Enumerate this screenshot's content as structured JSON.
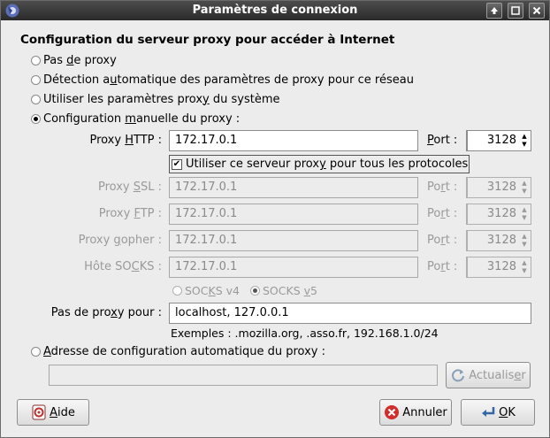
{
  "window": {
    "title": "Paramètres de connexion"
  },
  "section": {
    "heading": "Configuration du serveur proxy pour accéder à Internet"
  },
  "proxy_modes": [
    {
      "label_pre": "Pas ",
      "label_u": "d",
      "label_post": "e proxy",
      "checked": false
    },
    {
      "label_pre": "Détection a",
      "label_u": "u",
      "label_post": "tomatique des paramètres de proxy pour ce réseau",
      "checked": false
    },
    {
      "label_pre": "Utiliser les paramètres prox",
      "label_u": "y",
      "label_post": " du système",
      "checked": false
    },
    {
      "label_pre": "Configuration ",
      "label_u": "m",
      "label_post": "anuelle du proxy :",
      "checked": true
    }
  ],
  "http": {
    "label_pre": "Proxy ",
    "label_u": "H",
    "label_post": "TTP :",
    "value": "172.17.0.1",
    "port_label_u": "P",
    "port_label_post": "ort :",
    "port": "3128"
  },
  "use_for_all": {
    "label_pre": "Utiliser ce serveur prox",
    "label_u": "y",
    "label_post": " pour tous les protocoles",
    "checked": true,
    "check_glyph": "✔"
  },
  "ssl": {
    "label_pre": "Proxy ",
    "label_u": "S",
    "label_post": "SL :",
    "value": "172.17.0.1",
    "port_label_pre": "Po",
    "port_label_u": "r",
    "port_label_post": "t :",
    "port": "3128"
  },
  "ftp": {
    "label_pre": "Proxy ",
    "label_u": "F",
    "label_post": "TP :",
    "value": "172.17.0.1",
    "port_label_pre": "Po",
    "port_label_u": "r",
    "port_label_post": "t :",
    "port": "3128"
  },
  "gopher": {
    "label_pre": "Proxy ",
    "label_u": "g",
    "label_post": "opher :",
    "value": "172.17.0.1",
    "port_label_pre": "Po",
    "port_label_u": "r",
    "port_label_post": "t :",
    "port": "3128"
  },
  "socks": {
    "label_pre": "Hôte SO",
    "label_u": "C",
    "label_post": "KS :",
    "value": "172.17.0.1",
    "port_label_pre": "Po",
    "port_label_u": "r",
    "port_label_post": "t :",
    "port": "3128",
    "v4_pre": "SOC",
    "v4_u": "K",
    "v4_post": "S v4",
    "v5_pre": "SOCKS ",
    "v5_u": "v",
    "v5_post": "5",
    "selected": "v5"
  },
  "no_proxy": {
    "label_pre": "Pas de pro",
    "label_u": "x",
    "label_post": "y pour :",
    "value": "localhost, 127.0.0.1",
    "examples": "Exemples : .mozilla.org, .asso.fr, 192.168.1.0/24"
  },
  "auto_config": {
    "label_u": "A",
    "label_post": "dresse de configuration automatique du proxy :",
    "checked": false,
    "value": "",
    "reload_pre": "Actualis",
    "reload_u": "e",
    "reload_post": "r"
  },
  "buttons": {
    "help_u": "A",
    "help_post": "ide",
    "cancel": "Annuler",
    "ok_u": "O",
    "ok_post": "K"
  },
  "arrows": {
    "up": "▲",
    "down": "▼"
  }
}
